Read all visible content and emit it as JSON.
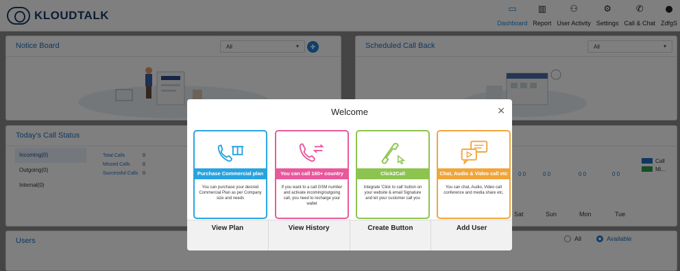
{
  "app": {
    "logo_text": "KLOUDTALK"
  },
  "nav": {
    "items": [
      {
        "label": "Dashboard",
        "icon": "monitor-icon",
        "active": true
      },
      {
        "label": "Report",
        "icon": "report-icon",
        "active": false
      },
      {
        "label": "User Activity",
        "icon": "users-icon",
        "active": false
      },
      {
        "label": "Settings",
        "icon": "gear-icon",
        "active": false
      },
      {
        "label": "Call & Chat",
        "icon": "phone-icon",
        "active": false
      },
      {
        "label": "ZdfgS",
        "icon": "avatar-icon",
        "active": false
      }
    ]
  },
  "notice_board": {
    "title": "Notice Board",
    "filter_value": "All"
  },
  "scheduled_call_back": {
    "title": "Scheduled Call Back",
    "filter_value": "All"
  },
  "todays_call_status": {
    "title": "Today's Call Status",
    "items": [
      "Incoming(0)",
      "Outgoing(0)",
      "Internal(0)"
    ],
    "totals": [
      {
        "label": "Total Calls",
        "value": "0"
      },
      {
        "label": "Missed Calls",
        "value": "0"
      },
      {
        "label": "Successful Calls",
        "value": "0"
      }
    ]
  },
  "chart": {
    "legend": [
      "Call",
      "Mi..."
    ],
    "colors": {
      "call": "#1e6fc0",
      "missed": "#2e9b4f"
    },
    "days": [
      "Sat",
      "Sun",
      "Mon",
      "Tue"
    ],
    "zero_pairs": [
      "0   0",
      "0   0",
      "0   0",
      "0   0"
    ]
  },
  "users": {
    "title": "Users",
    "filter_all": "All",
    "filter_available": "Available"
  },
  "welcome": {
    "title": "Welcome",
    "close": "×",
    "features": [
      {
        "title": "Purchase Commercial plan",
        "desc": "You can purchase your desired Commercial Plan as per Company size and needs",
        "icon": "phone-gift-icon",
        "color": "#29a3e0"
      },
      {
        "title": "You can call 160+ country",
        "desc": "If you want to a call GSM number and activate incoming/outgoing call, you need to recharge your wallet",
        "icon": "phone-transfer-icon",
        "color": "#e8589b"
      },
      {
        "title": "Click2Call",
        "desc": "Integrate 'Click to call' button on your website & email Signature and let your customer call you",
        "icon": "click-to-call-icon",
        "color": "#8cc44f"
      },
      {
        "title": "Chat, Audio & Video call etc",
        "desc": "You can chat, Audio, Video call conference and media share etc.",
        "icon": "chat-video-icon",
        "color": "#f0a53a"
      }
    ],
    "actions": [
      "View Plan",
      "View History",
      "Create Button",
      "Add User"
    ]
  }
}
